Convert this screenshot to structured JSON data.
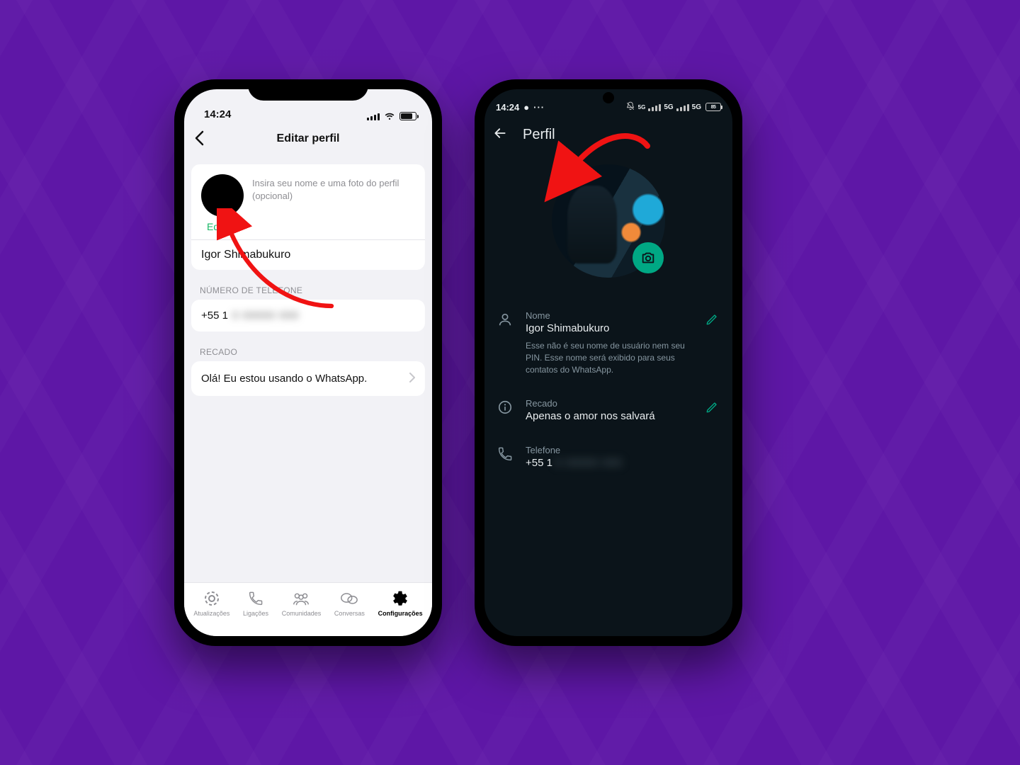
{
  "left": {
    "status_time": "14:24",
    "title": "Editar perfil",
    "desc": "Insira seu nome e uma foto do perfil (opcional)",
    "edit_label": "Editar",
    "name_value": "Igor Shimabukuro",
    "section_phone": "NÚMERO DE TELEFONE",
    "phone_prefix": "+55 1",
    "phone_hidden": "0 00000 000",
    "section_about": "RECADO",
    "about_value": "Olá! Eu estou usando o WhatsApp.",
    "tabs": {
      "updates": "Atualizações",
      "calls": "Ligações",
      "communities": "Comunidades",
      "chats": "Conversas",
      "settings": "Configurações"
    }
  },
  "right": {
    "status_time": "14:24",
    "status_net_a": "5G",
    "status_net_b": "5G",
    "status_batt": "85",
    "title": "Perfil",
    "name_label": "Nome",
    "name_value": "Igor Shimabukuro",
    "name_hint": "Esse não é seu nome de usuário nem seu PIN. Esse nome será exibido para seus contatos do WhatsApp.",
    "about_label": "Recado",
    "about_value": "Apenas o amor nos salvará",
    "phone_label": "Telefone",
    "phone_prefix": "+55 1",
    "phone_hidden": "0 00000 000"
  }
}
